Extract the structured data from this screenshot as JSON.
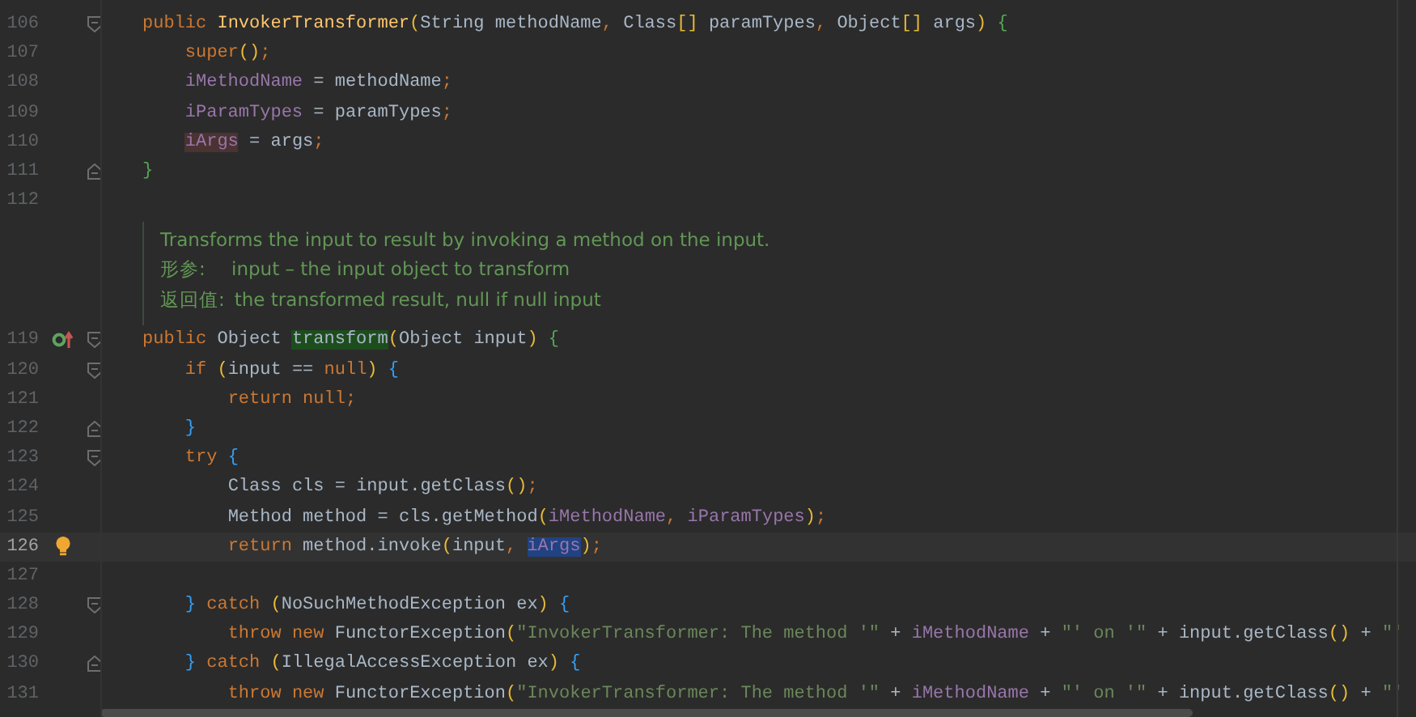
{
  "lines": [
    {
      "kind": "code",
      "number": "106",
      "current": false,
      "fold_marker": {
        "kind": "start"
      },
      "segments": [
        {
          "text": "public InvokerTransformer(String methodName, Class[] paramTypes, Object[] args) {"
        }
      ]
    },
    {
      "kind": "code",
      "number": "107",
      "current": false,
      "segments": [
        {
          "text": "super();"
        }
      ]
    },
    {
      "kind": "code",
      "number": "108",
      "current": false,
      "segments": [
        {
          "text": "iMethodName = methodName;"
        }
      ]
    },
    {
      "kind": "code",
      "number": "109",
      "current": false,
      "segments": [
        {
          "text": "iParamTypes = paramTypes;"
        }
      ]
    },
    {
      "kind": "code",
      "number": "110",
      "current": false,
      "segments": [
        {
          "text": "iArgs",
          "highlight": {
            "kind": "write"
          }
        },
        {
          "text": " = args;"
        }
      ]
    },
    {
      "kind": "code",
      "number": "111",
      "current": false,
      "fold_marker": {
        "kind": "end"
      },
      "segments": [
        {
          "text": "}"
        }
      ]
    },
    {
      "kind": "code",
      "number": "112",
      "current": false
    },
    {
      "kind": "doc",
      "summary": "Transforms the input to result by invoking a method on the input.",
      "params_label": "形参:",
      "param": "input – the input object to transform",
      "returns_label": "返回值:",
      "returns": "the transformed result, null if null input"
    },
    {
      "kind": "code",
      "number": "119",
      "current": false,
      "fold_marker": {
        "kind": "start"
      },
      "gutter_icon": {
        "kind": "override"
      },
      "segments": [
        {
          "text": "public Object "
        },
        {
          "text": "transform",
          "highlight": {
            "kind": "usage"
          }
        },
        {
          "text": "(Object input) {"
        }
      ]
    },
    {
      "kind": "code",
      "number": "120",
      "current": false,
      "fold_marker": {
        "kind": "start"
      },
      "segments": [
        {
          "text": "if (input == null) {"
        }
      ]
    },
    {
      "kind": "code",
      "number": "121",
      "current": false,
      "segments": [
        {
          "text": "return null;"
        }
      ]
    },
    {
      "kind": "code",
      "number": "122",
      "current": false,
      "fold_marker": {
        "kind": "end"
      },
      "segments": [
        {
          "text": "}"
        }
      ]
    },
    {
      "kind": "code",
      "number": "123",
      "current": false,
      "fold_marker": {
        "kind": "start"
      },
      "segments": [
        {
          "text": "try {"
        }
      ]
    },
    {
      "kind": "code",
      "number": "124",
      "current": false,
      "segments": [
        {
          "text": "Class cls = input.getClass();"
        }
      ]
    },
    {
      "kind": "code",
      "number": "125",
      "current": false,
      "segments": [
        {
          "text": "Method method = cls.getMethod(iMethodName, iParamTypes);"
        }
      ]
    },
    {
      "kind": "code",
      "number": "126",
      "current": true,
      "gutter_icon": {
        "kind": "bulb"
      },
      "segments": [
        {
          "text": "return method.invoke(input, "
        },
        {
          "text": "iArgs",
          "highlight": {
            "kind": "selection"
          }
        },
        {
          "text": ");"
        }
      ]
    },
    {
      "kind": "code",
      "number": "127",
      "current": false
    },
    {
      "kind": "code",
      "number": "128",
      "current": false,
      "fold_marker": {
        "kind": "start"
      },
      "segments": [
        {
          "text": "} catch (NoSuchMethodException ex) {"
        }
      ]
    },
    {
      "kind": "code",
      "number": "129",
      "current": false,
      "segments": [
        {
          "text": "throw new FunctorException(\"InvokerTransformer: The method '\" + iMethodName + \"' on '\" + input.getClass() + \"'"
        }
      ]
    },
    {
      "kind": "code",
      "number": "130",
      "current": false,
      "fold_marker": {
        "kind": "end"
      },
      "segments": [
        {
          "text": "} catch (IllegalAccessException ex) {"
        }
      ]
    },
    {
      "kind": "code",
      "number": "131",
      "current": false,
      "segments": [
        {
          "text": "throw new FunctorException(\"InvokerTransformer: The method '\" + iMethodName + \"' on '\" + input.getClass() + \"'"
        }
      ]
    }
  ]
}
